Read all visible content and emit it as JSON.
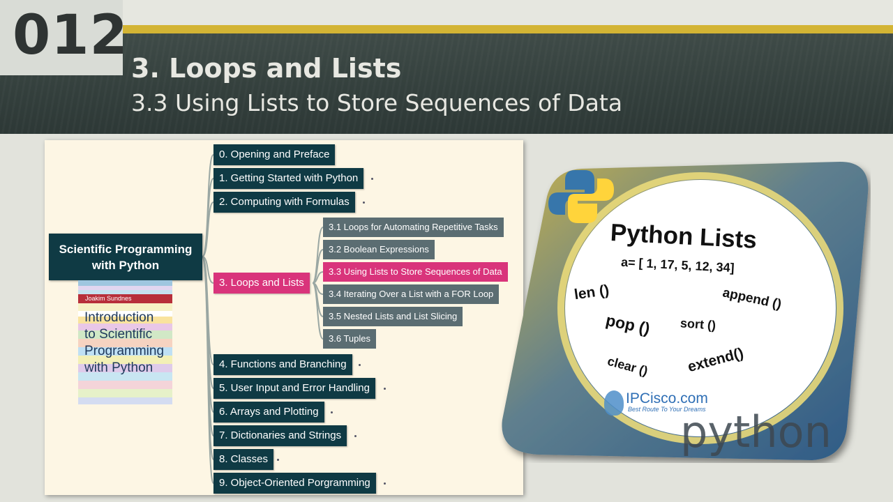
{
  "header": {
    "number": "012",
    "title": "3. Loops and Lists",
    "subtitle": "3.3 Using Lists to Store Sequences of Data"
  },
  "mindmap": {
    "root": [
      "Scientific Programming",
      "with Python"
    ],
    "chapters": [
      "0. Opening and Preface",
      "1. Getting Started with Python",
      "2. Computing with Formulas",
      "3. Loops and Lists",
      "4. Functions and Branching",
      "5. User Input and Error Handling",
      "6. Arrays and Plotting",
      "7. Dictionaries and Strings",
      "8. Classes",
      "9. Object-Oriented Porgramming"
    ],
    "sections": [
      "3.1 Loops for Automating Repetitive Tasks",
      "3.2 Boolean Expressions",
      "3.3 Using Lists to Store Sequences of Data",
      "3.4 Iterating Over a List with a FOR Loop",
      "3.5 Nested Lists and List Slicing",
      "3.6 Tuples"
    ],
    "highlight_color": "#d9347b",
    "node_color": "#0f3a44"
  },
  "book": {
    "author": "Joakim Sundnes",
    "title_lines": [
      "Introduction",
      "to Scientific",
      "Programming",
      "with Python"
    ]
  },
  "python_image": {
    "title": "Python Lists",
    "code": "a= [ 1, 17, 5, 12, 34]",
    "methods": [
      "len ()",
      "append ()",
      "pop ()",
      "sort ()",
      "clear ()",
      "extend()"
    ],
    "watermark": "IPCisco.com",
    "watermark_tagline": "Best Route To Your Dreams",
    "wordmark": "python"
  }
}
